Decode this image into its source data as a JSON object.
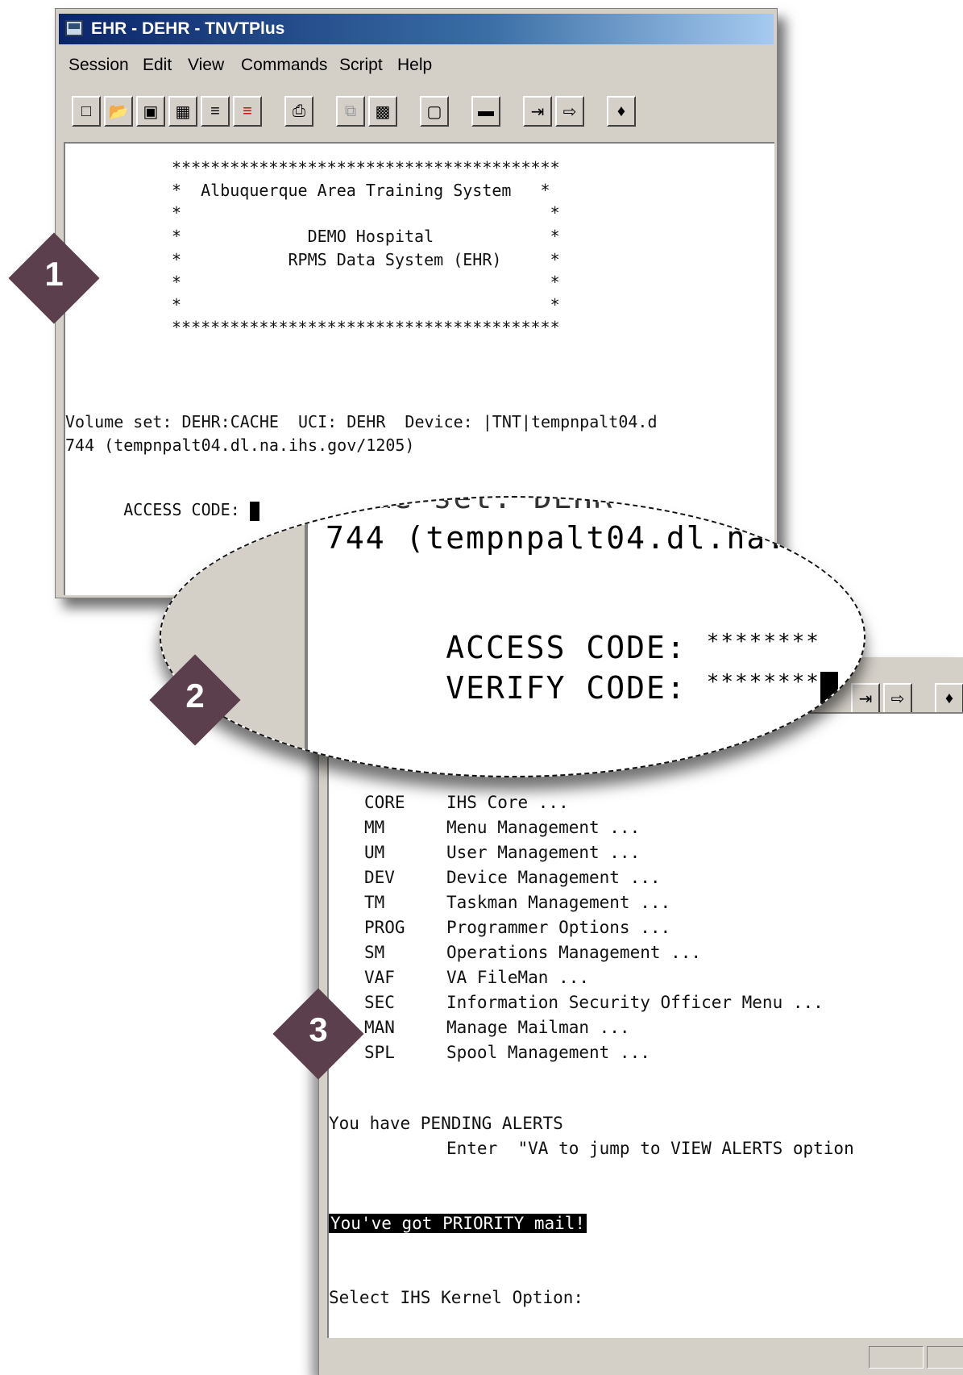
{
  "window1": {
    "title": "EHR - DEHR - TNVTPlus",
    "menu": [
      "Session",
      "Edit",
      "View",
      "Commands",
      "Script",
      "Help"
    ],
    "toolbar_icons": [
      "new-icon",
      "open-icon",
      "save-icon",
      "properties-icon",
      "capture-icon",
      "record-icon",
      "print-icon",
      "copy-icon",
      "paste-icon",
      "screen-icon",
      "keyboard-icon",
      "import-icon",
      "export-icon",
      "help-book-icon"
    ],
    "banner": [
      "****************************************",
      "*  Albuquerque Area Training System   *",
      "*                                      *",
      "*             DEMO Hospital            *",
      "*           RPMS Data System (EHR)     *",
      "*                                      *",
      "*                                      *",
      "****************************************"
    ],
    "volume_line": "Volume set: DEHR:CACHE  UCI: DEHR  Device: |TNT|tempnpalt04.d",
    "volume_line2": "744 (tempnpalt04.dl.na.ihs.gov/1205)",
    "access_prompt": "ACCESS CODE: "
  },
  "zoom": {
    "partial_line": "ume set: DEHR",
    "line1": "744 (tempnpalt04.dl.na.",
    "access_label": "ACCESS CODE: ",
    "access_mask": "********",
    "verify_label": "VERIFY CODE: ",
    "verify_mask": "********"
  },
  "window3": {
    "menu_items": [
      {
        "code": "CORE",
        "label": "IHS Core ..."
      },
      {
        "code": "MM",
        "label": "Menu Management ..."
      },
      {
        "code": "UM",
        "label": "User Management ..."
      },
      {
        "code": "DEV",
        "label": "Device Management ..."
      },
      {
        "code": "TM",
        "label": "Taskman Management ..."
      },
      {
        "code": "PROG",
        "label": "Programmer Options ..."
      },
      {
        "code": "SM",
        "label": "Operations Management ..."
      },
      {
        "code": "VAF",
        "label": "VA FileMan ..."
      },
      {
        "code": "SEC",
        "label": "Information Security Officer Menu ..."
      },
      {
        "code": "MAN",
        "label": "Manage Mailman ..."
      },
      {
        "code": "SPL",
        "label": "Spool Management ..."
      }
    ],
    "alerts_line1": "You have PENDING ALERTS",
    "alerts_line2": "Enter  \"VA to jump to VIEW ALERTS option",
    "priority_mail": "You've got PRIORITY mail!",
    "select_prompt": "Select IHS Kernel Option:"
  },
  "steps": [
    "1",
    "2",
    "3"
  ],
  "colors": {
    "step_badge": "#5c3f4c",
    "titlebar_start": "#0a246a",
    "window_face": "#d4d0c8"
  }
}
